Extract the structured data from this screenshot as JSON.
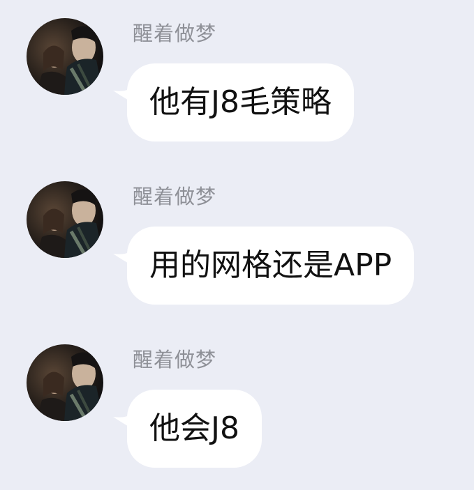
{
  "chat": {
    "messages": [
      {
        "sender": "醒着做梦",
        "text": "他有J8毛策略"
      },
      {
        "sender": "醒着做梦",
        "text": "用的网格还是APP"
      },
      {
        "sender": "醒着做梦",
        "text": "他会J8"
      }
    ]
  },
  "icons": {
    "avatar": "user-avatar-photo"
  },
  "colors": {
    "background": "#EBEDF5",
    "bubble": "#FFFFFF",
    "sender_name": "#8E9097",
    "message_text": "#111111"
  }
}
